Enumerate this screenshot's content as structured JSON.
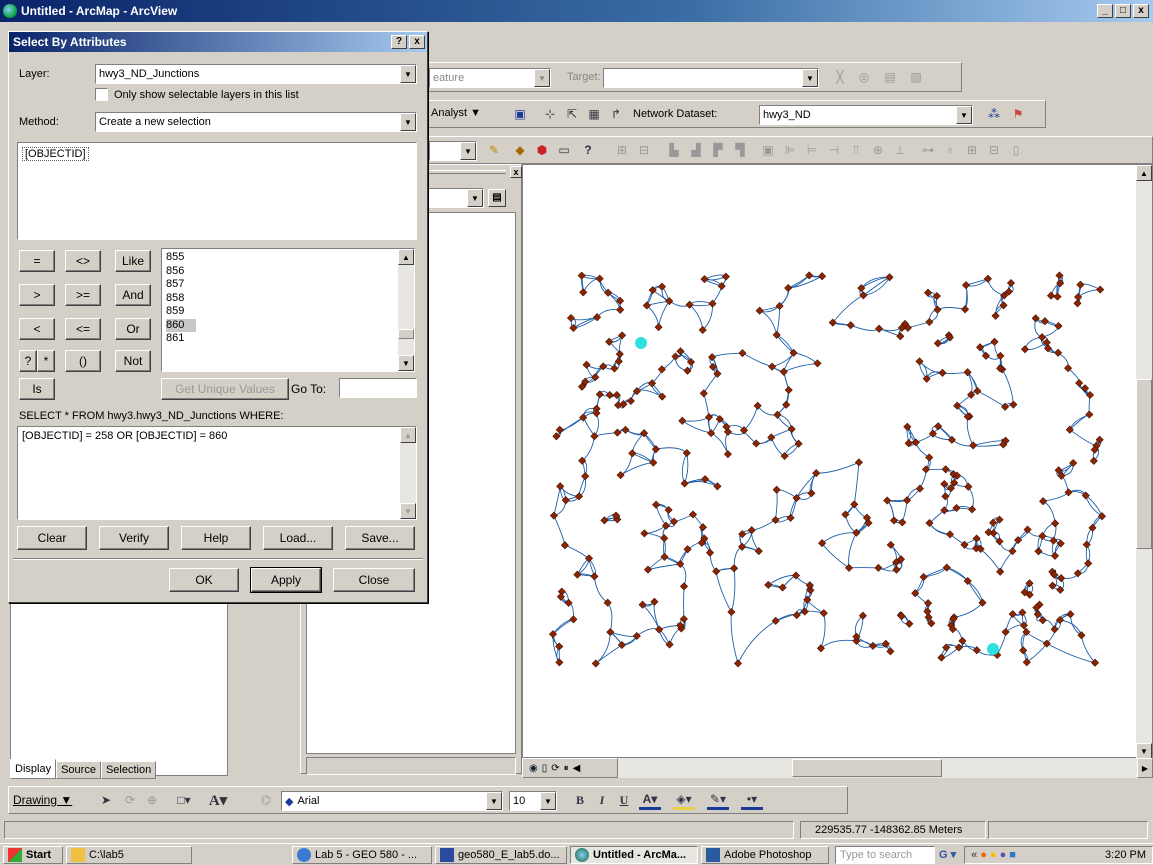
{
  "window": {
    "title": "Untitled - ArcMap - ArcView",
    "min": "_",
    "max": "□",
    "close": "x"
  },
  "toolbar1": {
    "feature_label": "eature",
    "target_label": "Target:"
  },
  "toolbar2": {
    "analyst_label": "Analyst ▼",
    "network_dataset_label": "Network Dataset:",
    "network_dataset_value": "hwy3_ND"
  },
  "dialog": {
    "title": "Select By Attributes",
    "help_btn": "?",
    "close_btn": "x",
    "layer_label": "Layer:",
    "layer_value": "hwy3_ND_Junctions",
    "only_selectable_label": "Only show selectable layers in this list",
    "method_label": "Method:",
    "method_value": "Create a new selection",
    "fields": [
      "[OBJECTID]"
    ],
    "operators": [
      "=",
      "<>",
      "Like",
      ">",
      ">=",
      "And",
      "<",
      "<=",
      "Or",
      "?",
      "*",
      "()",
      "Not",
      "Is"
    ],
    "values": [
      "855",
      "856",
      "857",
      "858",
      "859",
      "860",
      "861"
    ],
    "selected_value": "860",
    "get_unique_label": "Get Unique Values",
    "goto_label": "Go To:",
    "sql_label": "SELECT * FROM hwy3.hwy3_ND_Junctions WHERE:",
    "sql_text": "[OBJECTID] = 258 OR [OBJECTID] = 860",
    "buttons_row1": [
      "Clear",
      "Verify",
      "Help",
      "Load...",
      "Save..."
    ],
    "buttons_row2": [
      "OK",
      "Apply",
      "Close"
    ]
  },
  "toc_tabs": [
    "Display",
    "Source",
    "Selection"
  ],
  "drawing_toolbar": {
    "drawing_label": "Drawing ▼",
    "font": "Arial",
    "size": "10",
    "bold": "B",
    "italic": "I",
    "underline": "U"
  },
  "status": {
    "coords": "229535.77  -148362.85 Meters"
  },
  "taskbar": {
    "start": "Start",
    "items": [
      "C:\\lab5",
      "Lab 5 - GEO 580 - ...",
      "geo580_E_lab5.do...",
      "Untitled - ArcMa...",
      "Adobe Photoshop"
    ],
    "search_placeholder": "Type to search",
    "clock": "3:20 PM"
  },
  "colors": {
    "title_blue": "#0a246a",
    "junction": "#8b2500",
    "road": "#1f5fa8",
    "selected": "#2fe0e0"
  },
  "map": {
    "selected_junctions": [
      "258",
      "860"
    ]
  }
}
